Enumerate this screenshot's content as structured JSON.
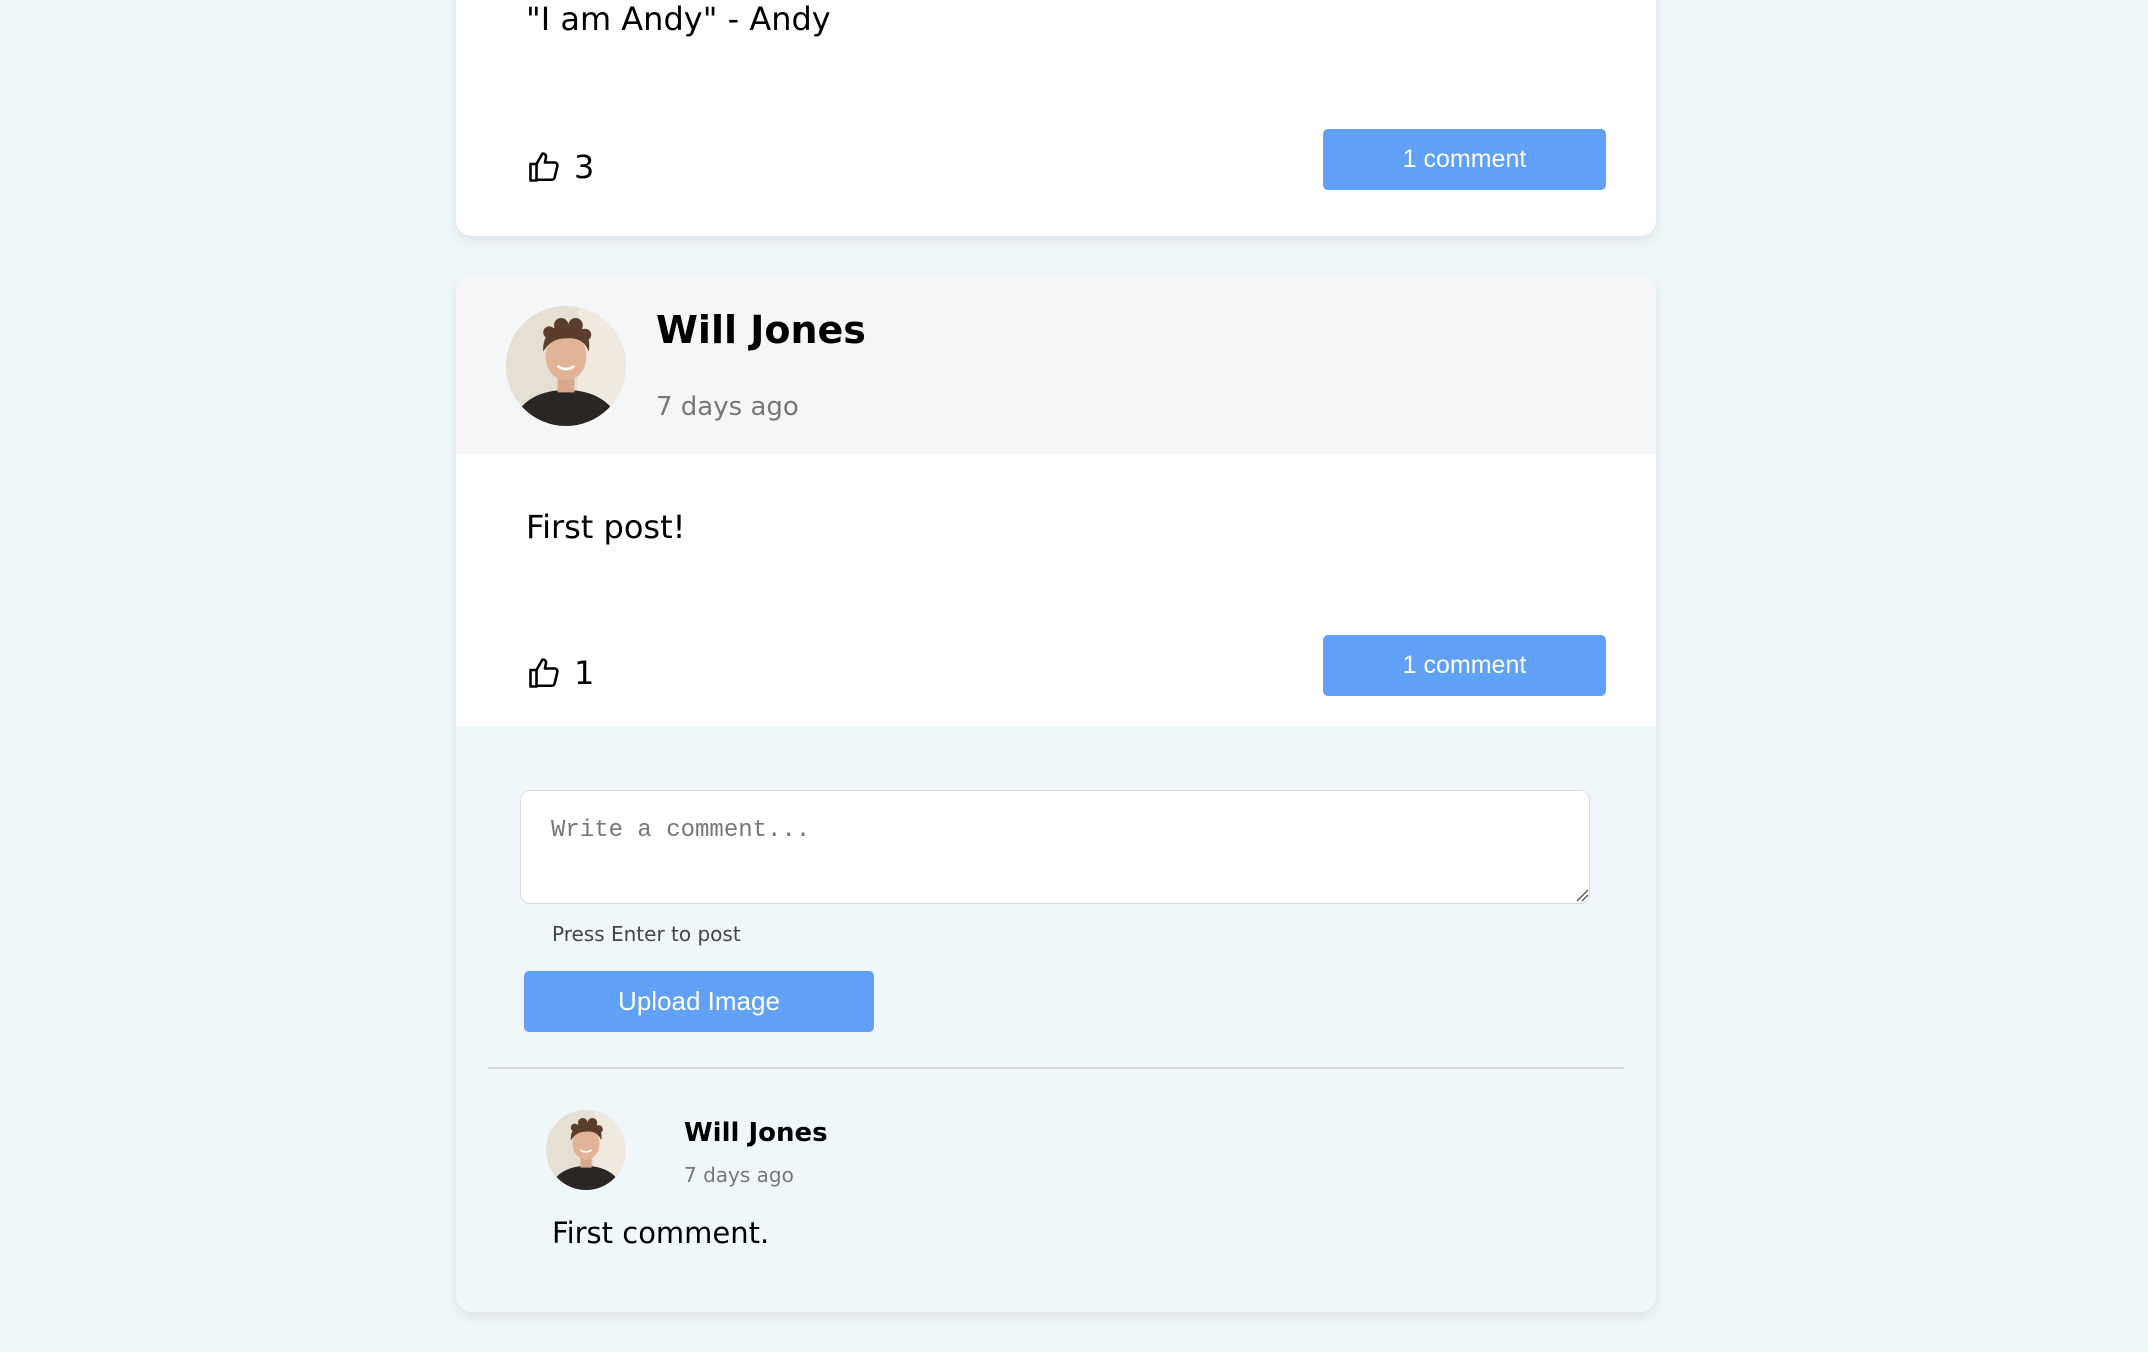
{
  "posts": [
    {
      "text": "\"I am Andy\" - Andy",
      "likes": "3",
      "comment_button": "1 comment"
    },
    {
      "author": "Will Jones",
      "time": "7 days ago",
      "text": "First post!",
      "likes": "1",
      "comment_button": "1 comment",
      "comment_input": {
        "placeholder": "Write a comment...",
        "value": ""
      },
      "hint": "Press Enter to post",
      "upload_label": "Upload Image",
      "comments": [
        {
          "author": "Will Jones",
          "time": "7 days ago",
          "text": "First comment."
        }
      ]
    }
  ],
  "colors": {
    "page_background": "#f0f7fb",
    "card_background": "#ffffff",
    "header_background": "#f5f6f7",
    "button_blue": "#60a0f7"
  },
  "icons": {
    "like": "thumbs-up-icon",
    "avatar": "user-avatar-photo"
  }
}
